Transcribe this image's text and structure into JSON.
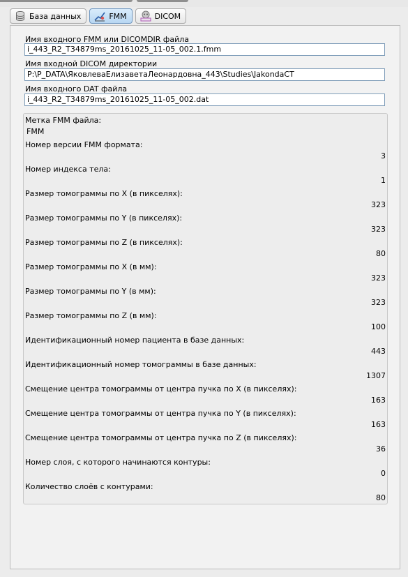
{
  "tabs": [
    {
      "label": "База данных",
      "icon": "database-icon"
    },
    {
      "label": "FMM",
      "icon": "fmm-icon",
      "active": true
    },
    {
      "label": "DICOM",
      "icon": "dicom-icon"
    }
  ],
  "fields": {
    "fmm_label": "Имя входного FMM или DICOMDIR файла",
    "fmm_value": "i_443_R2_T34879ms_20161025_11-05_002.1.fmm",
    "dicom_label": "Имя входной DICOM директории",
    "dicom_value": "P:\\P_DATA\\ЯковлеваЕлизаветаЛеонардовна_443\\Studies\\JakondaCT",
    "dat_label": "Имя входного DAT файла",
    "dat_value": "i_443_R2_T34879ms_20161025_11-05_002.dat"
  },
  "info": {
    "mark_label": "Метка FMM файла:",
    "mark_value": "FMM",
    "rows": [
      {
        "label": "Номер версии FMM формата:",
        "value": "3"
      },
      {
        "label": "Номер индекса тела:",
        "value": "1"
      },
      {
        "label": "Размер томограммы по X (в пикселях):",
        "value": "323"
      },
      {
        "label": "Размер томограммы по Y (в пикселях):",
        "value": "323"
      },
      {
        "label": "Размер томограммы по Z (в пикселях):",
        "value": "80"
      },
      {
        "label": "Размер томограммы по X (в мм):",
        "value": "323"
      },
      {
        "label": "Размер томограммы по Y (в мм):",
        "value": "323"
      },
      {
        "label": "Размер томограммы по Z (в мм):",
        "value": "100"
      },
      {
        "label": "Идентификационный номер пациента в базе данных:",
        "value": "443"
      },
      {
        "label": "Идентификационный номер томограммы в базе данных:",
        "value": "1307"
      },
      {
        "label": "Смещение центра томограммы от центра пучка по X (в пикселях):",
        "value": "163"
      },
      {
        "label": "Смещение центра томограммы от центра пучка по Y (в пикселях):",
        "value": "163"
      },
      {
        "label": "Смещение центра томограммы от центра пучка по Z (в пикселях):",
        "value": "36"
      },
      {
        "label": "Номер слоя, с которого начинаются контуры:",
        "value": "0"
      },
      {
        "label": "Количество слоёв с контурами:",
        "value": "80"
      }
    ]
  },
  "colors": {
    "active_tab": "#b7d6f2",
    "input_border": "#7f9db9",
    "panel_bg": "#f2f2f2"
  }
}
